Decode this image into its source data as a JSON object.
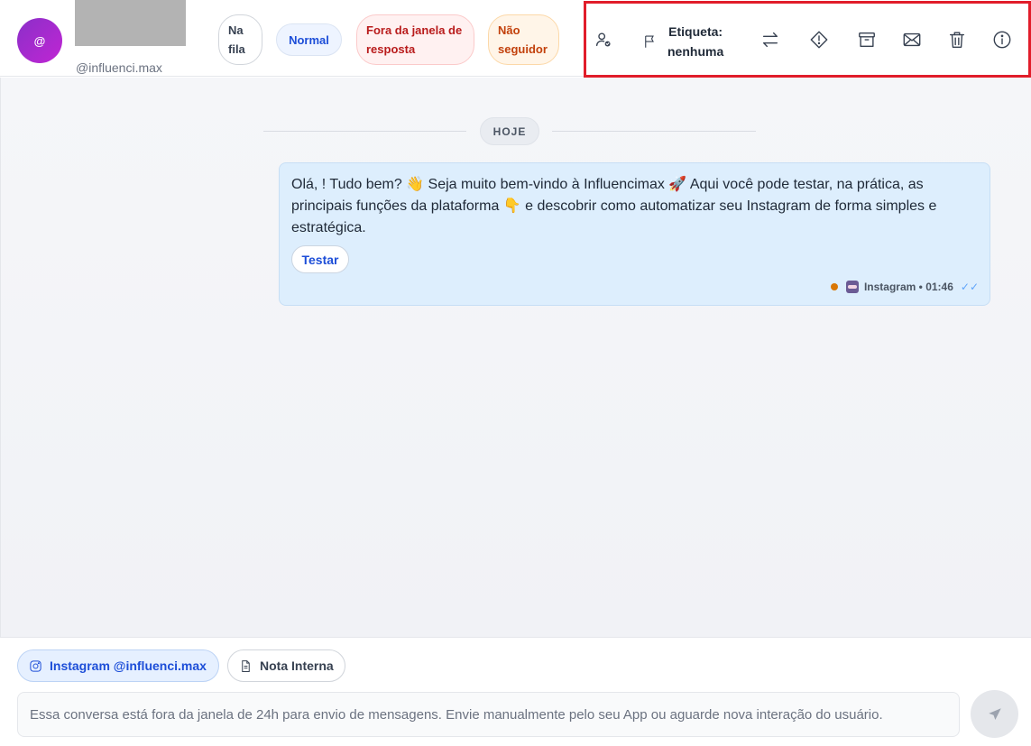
{
  "contact": {
    "avatar_text": "@",
    "handle": "@influenci.max"
  },
  "status_chips": {
    "queue": "Na fila",
    "priority": "Normal",
    "window": "Fora da janela de resposta",
    "follower": "Não seguidor"
  },
  "toolbar": {
    "label_title": "Etiqueta:",
    "label_value": "nenhuma"
  },
  "chat": {
    "day_divider": "HOJE",
    "message": {
      "text": "Olá, ! Tudo bem? 👋 Seja muito bem-vindo à Influencimax 🚀 Aqui você pode testar, na prática, as principais funções da plataforma 👇 e descobrir como automatizar seu Instagram de forma simples e estratégica.",
      "button_label": "Testar",
      "channel": "Instagram",
      "time": "01:46",
      "ticks": "✓✓"
    }
  },
  "composer": {
    "tab_channel": "Instagram @influenci.max",
    "tab_note": "Nota Interna",
    "input_text": "Essa conversa está fora da janela de 24h para envio de mensagens. Envie manualmente pelo seu App ou aguarde nova interação do usuário."
  },
  "colors": {
    "accent": "#1d4ed8",
    "highlight_box": "#e11d2a",
    "bubble": "#ddeefd"
  }
}
